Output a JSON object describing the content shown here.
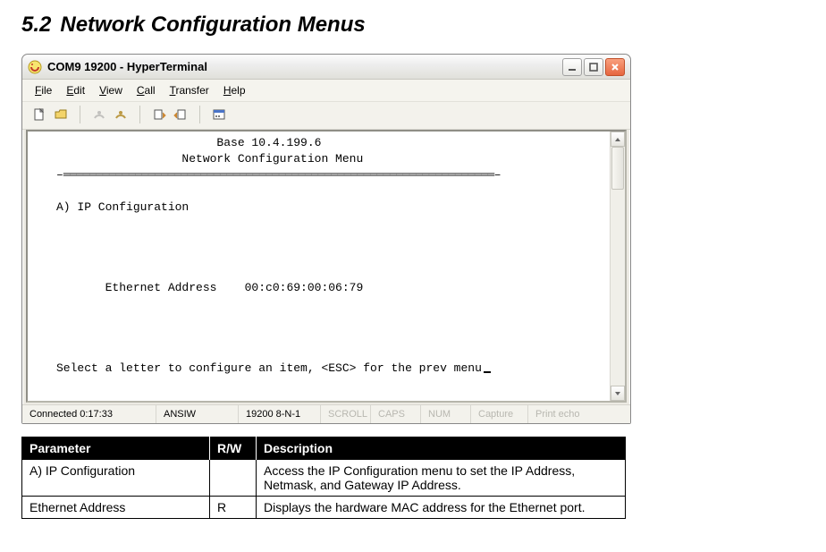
{
  "section": {
    "number": "5.2",
    "title": "Network Configuration Menus"
  },
  "window": {
    "title": "COM9 19200 - HyperTerminal"
  },
  "menubar": {
    "items": [
      {
        "text": "File",
        "u": 0
      },
      {
        "text": "Edit",
        "u": 0
      },
      {
        "text": "View",
        "u": 0
      },
      {
        "text": "Call",
        "u": 0
      },
      {
        "text": "Transfer",
        "u": 0
      },
      {
        "text": "Help",
        "u": 0
      }
    ]
  },
  "terminal": {
    "header_base": "                       Base 10.4.199.6",
    "header_menu": "                  Network Configuration Menu",
    "rule_left": "–",
    "rule_right": "–",
    "option_a": "A) IP Configuration",
    "eth_line": "       Ethernet Address    00:c0:69:00:06:79",
    "prompt": "Select a letter to configure an item, <ESC> for the prev menu"
  },
  "statusbar": {
    "connected": "Connected 0:17:33",
    "emulation": "ANSIW",
    "settings": "19200 8-N-1",
    "scroll": "SCROLL",
    "caps": "CAPS",
    "num": "NUM",
    "capture": "Capture",
    "printecho": "Print echo"
  },
  "table": {
    "headers": {
      "param": "Parameter",
      "rw": "R/W",
      "desc": "Description"
    },
    "rows": [
      {
        "param": "A) IP Configuration",
        "rw": "",
        "desc": "Access the IP Configuration menu to set the IP Address, Netmask, and Gateway IP Address."
      },
      {
        "param": "Ethernet Address",
        "rw": "R",
        "desc": "Displays the hardware MAC address for the Ethernet port."
      }
    ]
  }
}
